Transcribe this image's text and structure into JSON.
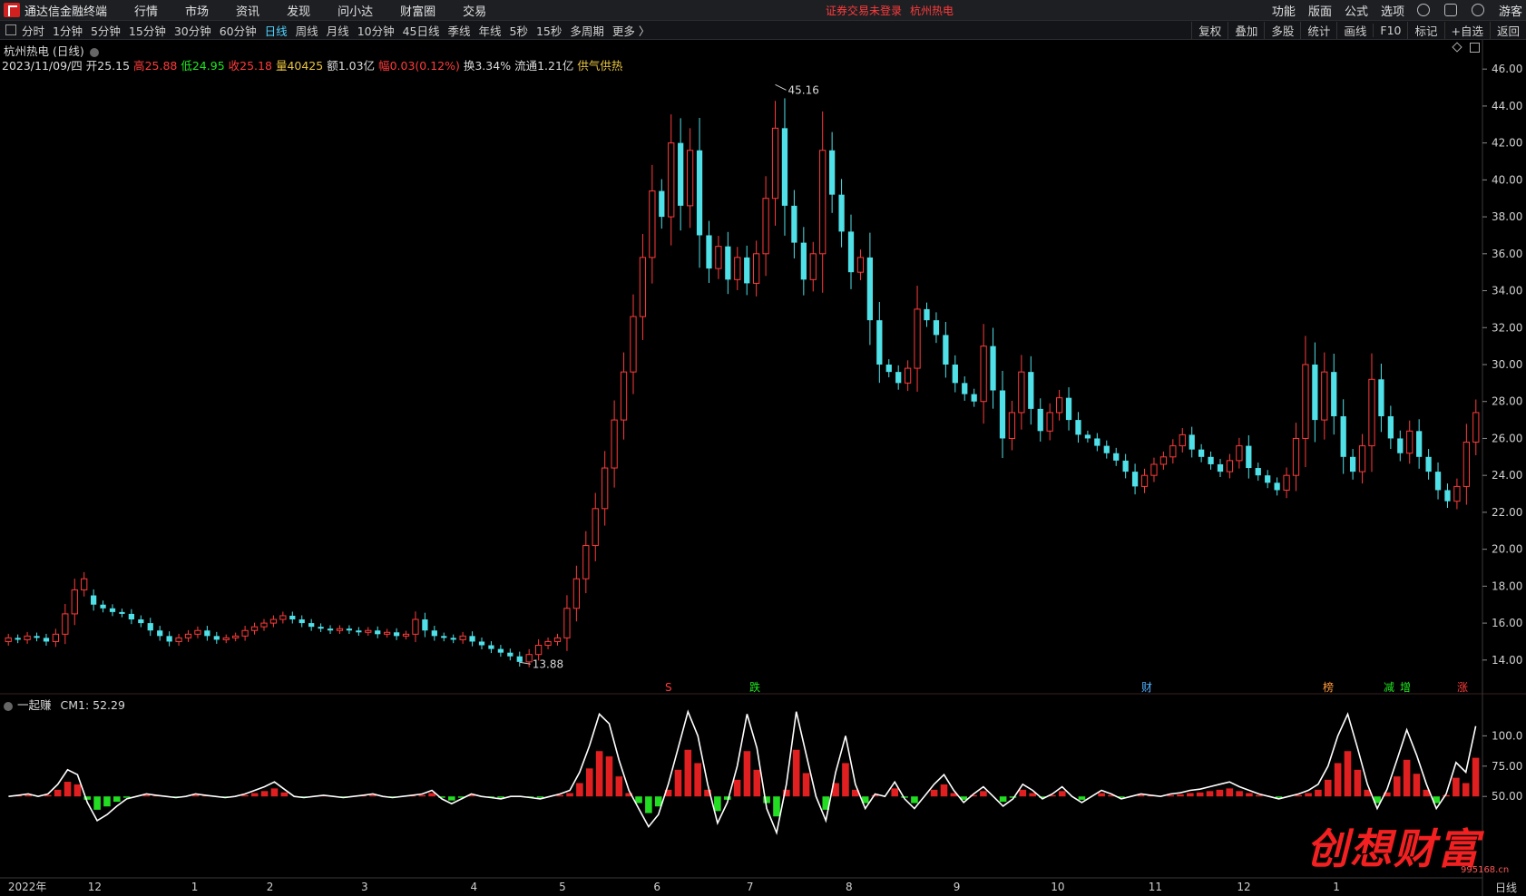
{
  "menubar": {
    "app_title": "通达信金融终端",
    "items": [
      "行情",
      "市场",
      "资讯",
      "发现",
      "问小达",
      "财富圈",
      "交易"
    ],
    "login_warning": "证券交易未登录",
    "stock_title": "杭州热电",
    "right_items": [
      "功能",
      "版面",
      "公式",
      "选项"
    ],
    "guest": "游客"
  },
  "toolbar": {
    "periods": [
      "分时",
      "1分钟",
      "5分钟",
      "15分钟",
      "30分钟",
      "60分钟",
      "日线",
      "周线",
      "月线",
      "10分钟",
      "45日线",
      "季线",
      "年线",
      "5秒",
      "15秒",
      "多周期",
      "更多 〉"
    ],
    "active_period": "日线",
    "right_tools": [
      "复权",
      "叠加",
      "多股",
      "统计",
      "画线",
      "F10",
      "标记",
      "+自选",
      "返回"
    ]
  },
  "chart": {
    "title": "杭州热电 (日线)",
    "date": "2023/11/09/四",
    "open_label": "开",
    "open": "25.15",
    "high_label": "高",
    "high": "25.88",
    "low_label": "低",
    "low": "24.95",
    "close_label": "收",
    "close": "25.18",
    "volume_label": "量",
    "volume": "40425",
    "amount_label": "额",
    "amount": "1.03亿",
    "change_label": "幅",
    "change": "0.03(0.12%)",
    "turnover_label": "换",
    "turnover": "3.34%",
    "float_label": "流通",
    "float_cap": "1.21亿",
    "signal": "供气供热",
    "max_price_label": "45.16",
    "min_price_label": "13.88",
    "y_ticks": [
      "46.00",
      "44.00",
      "42.00",
      "40.00",
      "38.00",
      "36.00",
      "34.00",
      "32.00",
      "30.00",
      "28.00",
      "26.00",
      "24.00",
      "22.00",
      "20.00",
      "18.00",
      "16.00",
      "14.00"
    ],
    "markers": [
      {
        "text": "S",
        "color": "#ff3b3b"
      },
      {
        "text": "跌",
        "color": "#1ee81e"
      },
      {
        "text": "财",
        "color": "#4fb0ff"
      },
      {
        "text": "榜",
        "color": "#ff9a3b"
      },
      {
        "text": "减",
        "color": "#1ee81e"
      },
      {
        "text": "增",
        "color": "#1ee81e"
      },
      {
        "text": "涨",
        "color": "#ff3b3b"
      }
    ]
  },
  "indicator": {
    "name": "一起赚",
    "value_label": "CM1: 52.29",
    "y_ticks": [
      "100.0",
      "75.00",
      "50.00"
    ]
  },
  "x_axis": {
    "labels": [
      "2022年",
      "12",
      "1",
      "2",
      "3",
      "4",
      "5",
      "6",
      "7",
      "8",
      "9",
      "10",
      "11",
      "12",
      "1"
    ],
    "period_label": "日线"
  },
  "watermark": {
    "text": "创想财富",
    "url": "995168.cn"
  },
  "chart_data": {
    "type": "candlestick",
    "series": [
      {
        "name": "price",
        "points": [
          [
            15.0,
            15.2
          ],
          [
            15.2,
            15.1
          ],
          [
            15.1,
            15.3
          ],
          [
            15.3,
            15.2
          ],
          [
            15.2,
            15.0
          ],
          [
            15.0,
            15.4
          ],
          [
            15.4,
            16.5
          ],
          [
            16.5,
            17.8
          ],
          [
            17.8,
            18.4
          ],
          [
            17.5,
            17.0
          ],
          [
            17.0,
            16.8
          ],
          [
            16.8,
            16.6
          ],
          [
            16.6,
            16.5
          ],
          [
            16.5,
            16.2
          ],
          [
            16.2,
            16.0
          ],
          [
            16.0,
            15.6
          ],
          [
            15.6,
            15.3
          ],
          [
            15.3,
            15.0
          ],
          [
            15.0,
            15.2
          ],
          [
            15.2,
            15.4
          ],
          [
            15.4,
            15.6
          ],
          [
            15.6,
            15.3
          ],
          [
            15.3,
            15.1
          ],
          [
            15.1,
            15.2
          ],
          [
            15.2,
            15.3
          ],
          [
            15.3,
            15.6
          ],
          [
            15.6,
            15.8
          ],
          [
            15.8,
            16.0
          ],
          [
            16.0,
            16.2
          ],
          [
            16.2,
            16.4
          ],
          [
            16.4,
            16.2
          ],
          [
            16.2,
            16.0
          ],
          [
            16.0,
            15.8
          ],
          [
            15.8,
            15.7
          ],
          [
            15.7,
            15.6
          ],
          [
            15.6,
            15.7
          ],
          [
            15.7,
            15.6
          ],
          [
            15.6,
            15.5
          ],
          [
            15.5,
            15.6
          ],
          [
            15.6,
            15.4
          ],
          [
            15.4,
            15.5
          ],
          [
            15.5,
            15.3
          ],
          [
            15.3,
            15.4
          ],
          [
            15.4,
            16.2
          ],
          [
            16.2,
            15.6
          ],
          [
            15.6,
            15.3
          ],
          [
            15.3,
            15.2
          ],
          [
            15.2,
            15.1
          ],
          [
            15.1,
            15.3
          ],
          [
            15.3,
            15.0
          ],
          [
            15.0,
            14.8
          ],
          [
            14.8,
            14.6
          ],
          [
            14.6,
            14.4
          ],
          [
            14.4,
            14.2
          ],
          [
            14.2,
            13.9
          ],
          [
            13.9,
            14.3
          ],
          [
            14.3,
            14.8
          ],
          [
            14.8,
            15.0
          ],
          [
            15.0,
            15.2
          ],
          [
            15.2,
            16.8
          ],
          [
            16.8,
            18.4
          ],
          [
            18.4,
            20.2
          ],
          [
            20.2,
            22.2
          ],
          [
            22.2,
            24.4
          ],
          [
            24.4,
            27.0
          ],
          [
            27.0,
            29.6
          ],
          [
            29.6,
            32.6
          ],
          [
            32.6,
            35.8
          ],
          [
            35.8,
            39.4
          ],
          [
            39.4,
            38.0
          ],
          [
            38.0,
            42.0
          ],
          [
            42.0,
            38.6
          ],
          [
            38.6,
            41.6
          ],
          [
            41.6,
            37.0
          ],
          [
            37.0,
            35.2
          ],
          [
            35.2,
            36.4
          ],
          [
            36.4,
            34.6
          ],
          [
            34.6,
            35.8
          ],
          [
            35.8,
            34.4
          ],
          [
            34.4,
            36.0
          ],
          [
            36.0,
            39.0
          ],
          [
            39.0,
            42.8
          ],
          [
            42.8,
            38.6
          ],
          [
            38.6,
            36.6
          ],
          [
            36.6,
            34.6
          ],
          [
            34.6,
            36.0
          ],
          [
            36.0,
            41.6
          ],
          [
            41.6,
            39.2
          ],
          [
            39.2,
            37.2
          ],
          [
            37.2,
            35.0
          ],
          [
            35.0,
            35.8
          ],
          [
            35.8,
            32.4
          ],
          [
            32.4,
            30.0
          ],
          [
            30.0,
            29.6
          ],
          [
            29.6,
            29.0
          ],
          [
            29.0,
            29.8
          ],
          [
            29.8,
            33.0
          ],
          [
            33.0,
            32.4
          ],
          [
            32.4,
            31.6
          ],
          [
            31.6,
            30.0
          ],
          [
            30.0,
            29.0
          ],
          [
            29.0,
            28.4
          ],
          [
            28.4,
            28.0
          ],
          [
            28.0,
            31.0
          ],
          [
            31.0,
            28.6
          ],
          [
            28.6,
            26.0
          ],
          [
            26.0,
            27.4
          ],
          [
            27.4,
            29.6
          ],
          [
            29.6,
            27.6
          ],
          [
            27.6,
            26.4
          ],
          [
            26.4,
            27.4
          ],
          [
            27.4,
            28.2
          ],
          [
            28.2,
            27.0
          ],
          [
            27.0,
            26.2
          ],
          [
            26.2,
            26.0
          ],
          [
            26.0,
            25.6
          ],
          [
            25.6,
            25.2
          ],
          [
            25.2,
            24.8
          ],
          [
            24.8,
            24.2
          ],
          [
            24.2,
            23.4
          ],
          [
            23.4,
            24.0
          ],
          [
            24.0,
            24.6
          ],
          [
            24.6,
            25.0
          ],
          [
            25.0,
            25.6
          ],
          [
            25.6,
            26.2
          ],
          [
            26.2,
            25.4
          ],
          [
            25.4,
            25.0
          ],
          [
            25.0,
            24.6
          ],
          [
            24.6,
            24.2
          ],
          [
            24.2,
            24.8
          ],
          [
            24.8,
            25.6
          ],
          [
            25.6,
            24.4
          ],
          [
            24.4,
            24.0
          ],
          [
            24.0,
            23.6
          ],
          [
            23.6,
            23.2
          ],
          [
            23.2,
            24.0
          ],
          [
            24.0,
            26.0
          ],
          [
            26.0,
            30.0
          ],
          [
            30.0,
            27.0
          ],
          [
            27.0,
            29.6
          ],
          [
            29.6,
            27.2
          ],
          [
            27.2,
            25.0
          ],
          [
            25.0,
            24.2
          ],
          [
            24.2,
            25.6
          ],
          [
            25.6,
            29.2
          ],
          [
            29.2,
            27.2
          ],
          [
            27.2,
            26.0
          ],
          [
            26.0,
            25.2
          ],
          [
            25.2,
            26.4
          ],
          [
            26.4,
            25.0
          ],
          [
            25.0,
            24.2
          ],
          [
            24.2,
            23.2
          ],
          [
            23.2,
            22.6
          ],
          [
            22.6,
            23.4
          ],
          [
            23.4,
            25.8
          ],
          [
            25.8,
            27.4
          ]
        ]
      },
      {
        "name": "CM1",
        "values": [
          50,
          51,
          52,
          50,
          52,
          60,
          72,
          68,
          45,
          30,
          35,
          42,
          48,
          50,
          52,
          51,
          50,
          49,
          50,
          52,
          51,
          50,
          49,
          50,
          52,
          55,
          58,
          62,
          56,
          50,
          49,
          50,
          51,
          50,
          49,
          50,
          51,
          52,
          50,
          49,
          50,
          51,
          52,
          55,
          48,
          44,
          48,
          52,
          50,
          49,
          48,
          50,
          50,
          49,
          48,
          50,
          52,
          55,
          70,
          92,
          118,
          110,
          80,
          55,
          40,
          25,
          35,
          60,
          90,
          120,
          100,
          60,
          28,
          45,
          75,
          118,
          90,
          40,
          20,
          60,
          120,
          85,
          50,
          30,
          70,
          100,
          60,
          40,
          52,
          50,
          62,
          48,
          40,
          50,
          60,
          68,
          55,
          45,
          52,
          58,
          50,
          42,
          48,
          60,
          55,
          48,
          52,
          58,
          50,
          45,
          50,
          55,
          52,
          48,
          50,
          52,
          51,
          50,
          52,
          53,
          55,
          56,
          58,
          60,
          62,
          58,
          55,
          52,
          50,
          48,
          50,
          52,
          55,
          60,
          75,
          100,
          118,
          90,
          60,
          40,
          56,
          80,
          105,
          84,
          60,
          40,
          52,
          78,
          70,
          108
        ]
      }
    ],
    "y_range_price": [
      13.5,
      46.5
    ],
    "y_range_indicator": [
      0,
      125
    ],
    "price_high": 45.16,
    "price_low": 13.88
  }
}
